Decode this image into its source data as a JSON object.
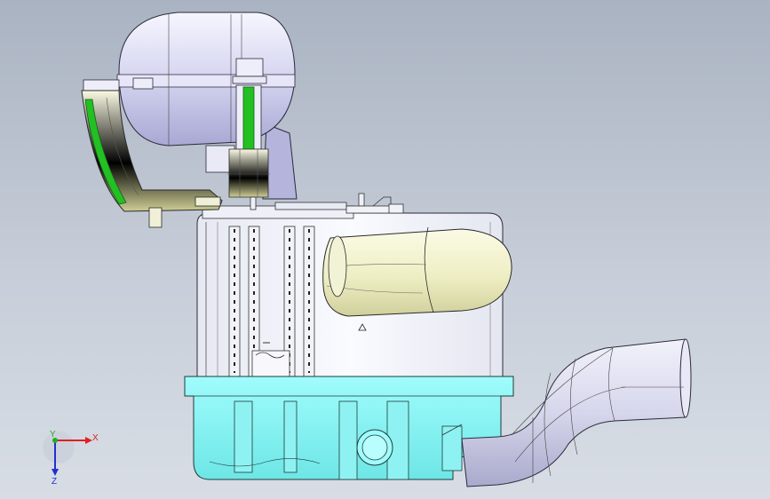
{
  "viewport": {
    "background_top": "#aab3c2",
    "background_bottom": "#d8dde5"
  },
  "triad": {
    "x_label": "X",
    "y_label": "Y",
    "z_label": "Z",
    "x_color": "#e02020",
    "y_color": "#20b020",
    "z_color": "#2030d0"
  },
  "model": {
    "tank_color": "#d4d4f0",
    "hose_color": "#f0f0c8",
    "base_color": "#7fffff",
    "pipe_color": "#d8d8ee",
    "highlight_color": "#22c022",
    "body_color": "#f4f6fb"
  }
}
